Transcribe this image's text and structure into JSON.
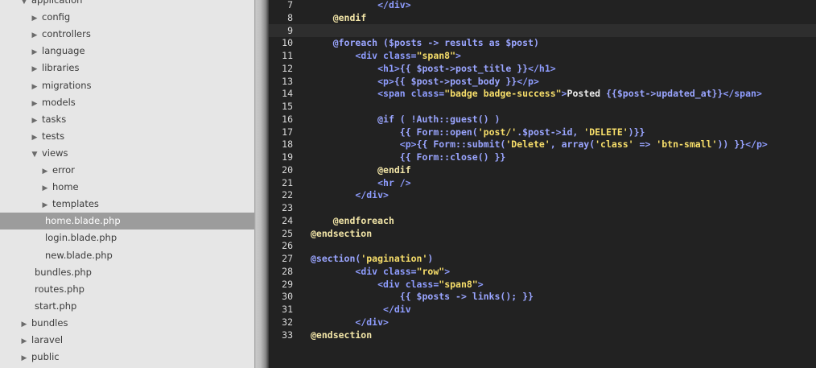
{
  "sidebar": {
    "items": [
      {
        "label": "application",
        "level": 0,
        "icon": "triangle-down-icon",
        "expanded": true
      },
      {
        "label": "config",
        "level": 1,
        "icon": "triangle-right-icon"
      },
      {
        "label": "controllers",
        "level": 1,
        "icon": "triangle-right-icon"
      },
      {
        "label": "language",
        "level": 1,
        "icon": "triangle-right-icon"
      },
      {
        "label": "libraries",
        "level": 1,
        "icon": "triangle-right-icon"
      },
      {
        "label": "migrations",
        "level": 1,
        "icon": "triangle-right-icon"
      },
      {
        "label": "models",
        "level": 1,
        "icon": "triangle-right-icon"
      },
      {
        "label": "tasks",
        "level": 1,
        "icon": "triangle-right-icon"
      },
      {
        "label": "tests",
        "level": 1,
        "icon": "triangle-right-icon"
      },
      {
        "label": "views",
        "level": 1,
        "icon": "triangle-down-icon",
        "expanded": true
      },
      {
        "label": "error",
        "level": 2,
        "icon": "triangle-right-icon"
      },
      {
        "label": "home",
        "level": 2,
        "icon": "triangle-right-icon"
      },
      {
        "label": "templates",
        "level": 2,
        "icon": "triangle-right-icon"
      },
      {
        "label": "home.blade.php",
        "level": 2,
        "file": true,
        "selected": true
      },
      {
        "label": "login.blade.php",
        "level": 2,
        "file": true
      },
      {
        "label": "new.blade.php",
        "level": 2,
        "file": true
      },
      {
        "label": "bundles.php",
        "level": 1,
        "file": true
      },
      {
        "label": "routes.php",
        "level": 1,
        "file": true
      },
      {
        "label": "start.php",
        "level": 1,
        "file": true
      },
      {
        "label": "bundles",
        "level": 0,
        "icon": "triangle-right-icon"
      },
      {
        "label": "laravel",
        "level": 0,
        "icon": "triangle-right-icon"
      },
      {
        "label": "public",
        "level": 0,
        "icon": "triangle-right-icon"
      }
    ]
  },
  "editor": {
    "highlight_line": 9,
    "lines": [
      {
        "n": "7",
        "segs": [
          [
            "            ",
            "txt"
          ],
          [
            "</div>",
            "tag"
          ]
        ]
      },
      {
        "n": "8",
        "segs": [
          [
            "    ",
            "txt"
          ],
          [
            "@endif",
            "kw"
          ]
        ]
      },
      {
        "n": "9",
        "segs": []
      },
      {
        "n": "10",
        "segs": [
          [
            "    ",
            "txt"
          ],
          [
            "@foreach ($posts -> results as $post)",
            "var"
          ]
        ]
      },
      {
        "n": "11",
        "segs": [
          [
            "        ",
            "txt"
          ],
          [
            "<div class=",
            "tag"
          ],
          [
            "\"span8\"",
            "str"
          ],
          [
            ">",
            "tag"
          ]
        ]
      },
      {
        "n": "12",
        "segs": [
          [
            "            ",
            "txt"
          ],
          [
            "<h1>",
            "tag"
          ],
          [
            "{{ $post->post_title }}",
            "var"
          ],
          [
            "</h1>",
            "tag"
          ]
        ]
      },
      {
        "n": "13",
        "segs": [
          [
            "            ",
            "txt"
          ],
          [
            "<p>",
            "tag"
          ],
          [
            "{{ $post->post_body }}",
            "var"
          ],
          [
            "</p>",
            "tag"
          ]
        ]
      },
      {
        "n": "14",
        "segs": [
          [
            "            ",
            "txt"
          ],
          [
            "<span class=",
            "tag"
          ],
          [
            "\"badge badge-success\"",
            "str"
          ],
          [
            ">",
            "tag"
          ],
          [
            "Posted ",
            "txt"
          ],
          [
            "{{$post->updated_at}}",
            "var"
          ],
          [
            "</span>",
            "tag"
          ]
        ]
      },
      {
        "n": "15",
        "segs": []
      },
      {
        "n": "16",
        "segs": [
          [
            "            ",
            "txt"
          ],
          [
            "@if ( !Auth::guest() )",
            "var"
          ]
        ]
      },
      {
        "n": "17",
        "segs": [
          [
            "                ",
            "txt"
          ],
          [
            "{{ Form::open(",
            "var"
          ],
          [
            "'post/'",
            "str"
          ],
          [
            ".$post->id, ",
            "var"
          ],
          [
            "'DELETE'",
            "str"
          ],
          [
            ")}}",
            "var"
          ]
        ]
      },
      {
        "n": "18",
        "segs": [
          [
            "                ",
            "txt"
          ],
          [
            "<p>",
            "tag"
          ],
          [
            "{{ Form::submit(",
            "var"
          ],
          [
            "'Delete'",
            "str"
          ],
          [
            ", array(",
            "var"
          ],
          [
            "'class'",
            "str"
          ],
          [
            " => ",
            "var"
          ],
          [
            "'btn-small'",
            "str"
          ],
          [
            ")) }}",
            "var"
          ],
          [
            "</p>",
            "tag"
          ]
        ]
      },
      {
        "n": "19",
        "segs": [
          [
            "                ",
            "txt"
          ],
          [
            "{{ Form::close() }}",
            "var"
          ]
        ]
      },
      {
        "n": "20",
        "segs": [
          [
            "            ",
            "txt"
          ],
          [
            "@endif",
            "kw"
          ]
        ]
      },
      {
        "n": "21",
        "segs": [
          [
            "            ",
            "txt"
          ],
          [
            "<hr />",
            "tag"
          ]
        ]
      },
      {
        "n": "22",
        "segs": [
          [
            "        ",
            "txt"
          ],
          [
            "</div>",
            "tag"
          ]
        ]
      },
      {
        "n": "23",
        "segs": []
      },
      {
        "n": "24",
        "segs": [
          [
            "    ",
            "txt"
          ],
          [
            "@endforeach",
            "kw"
          ]
        ]
      },
      {
        "n": "25",
        "segs": [
          [
            "@endsection",
            "kw"
          ]
        ]
      },
      {
        "n": "26",
        "segs": []
      },
      {
        "n": "27",
        "segs": [
          [
            "@section(",
            "var"
          ],
          [
            "'pagination'",
            "str"
          ],
          [
            ")",
            "var"
          ]
        ]
      },
      {
        "n": "28",
        "segs": [
          [
            "        ",
            "txt"
          ],
          [
            "<div class=",
            "tag"
          ],
          [
            "\"row\"",
            "str"
          ],
          [
            ">",
            "tag"
          ]
        ]
      },
      {
        "n": "29",
        "segs": [
          [
            "            ",
            "txt"
          ],
          [
            "<div class=",
            "tag"
          ],
          [
            "\"span8\"",
            "str"
          ],
          [
            ">",
            "tag"
          ]
        ]
      },
      {
        "n": "30",
        "segs": [
          [
            "                ",
            "txt"
          ],
          [
            "{{ $posts -> links(); }}",
            "var"
          ]
        ]
      },
      {
        "n": "31",
        "segs": [
          [
            "             ",
            "txt"
          ],
          [
            "</div",
            "tag"
          ]
        ]
      },
      {
        "n": "32",
        "segs": [
          [
            "        ",
            "txt"
          ],
          [
            "</div>",
            "tag"
          ]
        ]
      },
      {
        "n": "33",
        "segs": [
          [
            "@endsection",
            "kw"
          ]
        ]
      }
    ]
  }
}
